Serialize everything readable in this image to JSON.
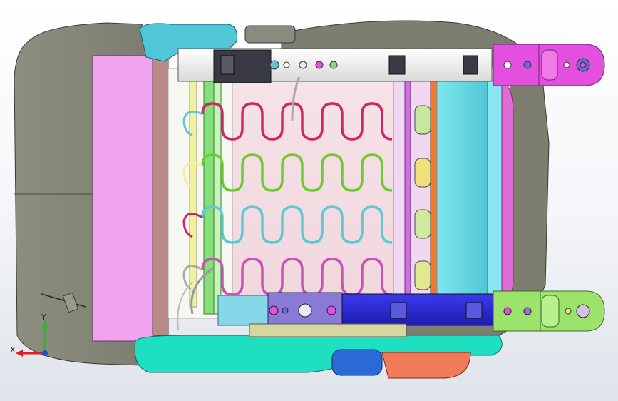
{
  "viewport": {
    "background_top": "#ffffff",
    "background_bottom": "#dfe4ea"
  },
  "triad": {
    "x_label": "X",
    "y_label": "Y",
    "x_color": "#e01b24",
    "y_color": "#2fb52f",
    "z_color": "#1f4fd6"
  },
  "model": {
    "cushion_color": "#868679",
    "trim_panel_color": "#f2a3ee",
    "spring_colors": [
      "#d0256a",
      "#6ecb2f",
      "#5cc9d6",
      "#c454b8"
    ],
    "front_rail_color": "#2b2bd6",
    "rear_rail_color": "#ffffff",
    "bracket_magenta": "#e34fdf",
    "bracket_green": "#9be36a",
    "side_frame_color": "#1ee0c0"
  }
}
